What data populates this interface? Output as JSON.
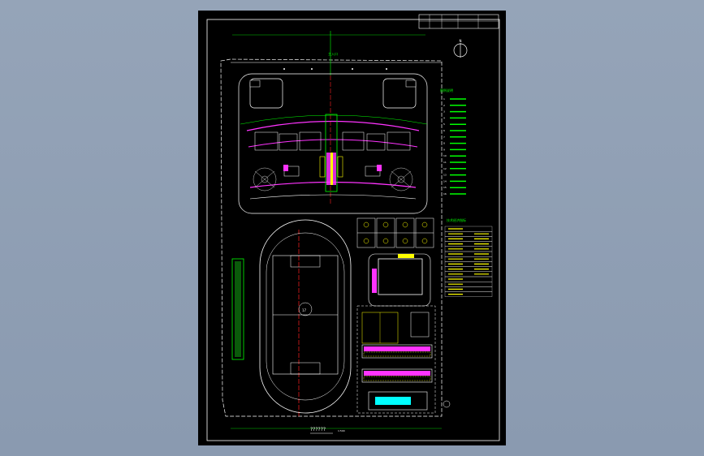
{
  "viewer": {
    "background": "#8f9fb4"
  },
  "drawing": {
    "sheet_background": "#000000",
    "frame_color": "#ffffff",
    "colors": {
      "green": "#00ff00",
      "white": "#ffffff",
      "red": "#ff2020",
      "magenta": "#ff33ff",
      "yellow": "#ffff00",
      "cyan": "#00ffff",
      "grey": "#888888"
    },
    "labels": {
      "gate": "主入口",
      "title": "??????",
      "scale": "1:500",
      "north": "N",
      "legend_header": "图例说明",
      "table_header": "技术经济指标",
      "center_mark": "17"
    },
    "legend_items": [
      "1",
      "2",
      "3",
      "4",
      "5",
      "6",
      "7",
      "8",
      "9",
      "10",
      "11",
      "12",
      "13",
      "14",
      "15",
      "16"
    ],
    "table_rows": 14
  }
}
